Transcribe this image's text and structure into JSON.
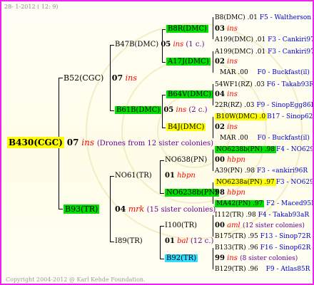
{
  "header": {
    "date_text": "28- 1-2012 ( 12: 9)"
  },
  "footer": {
    "copyright": "Copyright 2004-2012 @ Karl Kehde Foundation."
  },
  "root": {
    "label": "B430(CGC)",
    "year": "07",
    "breed": "ins",
    "note": "(Drones from 12 sister colonies)"
  },
  "father_side": {
    "label": "B52(CGC)",
    "year": "07",
    "breed": "ins",
    "gf": {
      "label": "B47B(DMC)",
      "year": "05",
      "breed": "ins",
      "note": "(1 c.)",
      "ggf": {
        "label": "B8R(DMC)",
        "year": "03",
        "breed": "ins",
        "l1": "B8(DMC) .01",
        "l1b": "F5 - Waltherson",
        "l2": "A199(DMC) .01",
        "l2b": "F3 - Cankiri97Q"
      },
      "ggm": {
        "label": "A17J(DMC)",
        "year": "02",
        "breed": "ins",
        "l1": "A199(DMC) .01",
        "l1b": "F3 - Cankiri97Q",
        "l2": "MAR .00",
        "l2b": "F0 - Buckfast(il)"
      }
    },
    "gm": {
      "label": "B61B(DMC)",
      "year": "05",
      "breed": "ins",
      "note": "(2 c.)",
      "ggf": {
        "label": "B64V(DMC)",
        "year": "04",
        "breed": "ins",
        "l1": "54WF1(RZ) .03",
        "l1b": "F6 - Takab93R",
        "l2": "22R(RZ) .03",
        "l2b": "F9 - SinopEgg86R"
      },
      "ggm": {
        "label": "B4J(DMC)",
        "year": "02",
        "breed": "ins",
        "l1": "B10W(DMC) .0",
        "l1b": "B17 - Sinop62R",
        "l2": "MAR .00",
        "l2b": "F0 - Buckfast(il)"
      }
    }
  },
  "mother_side": {
    "label": "B93(TR)",
    "year": "04",
    "breed": "mrk",
    "note": "(15 sister colonies)",
    "gf": {
      "label": "NO61(TR)",
      "year": "01",
      "breed": "hbpn",
      "ggf": {
        "label": "NO638(PN)",
        "year": "00",
        "breed": "hbpn",
        "l1": "NO6238b(PN) .98",
        "l1b": "F4 - NO6294R",
        "l2": "A39(PN) .98",
        "l2b": "F3 - «ankiri96R"
      },
      "ggm": {
        "label": "NO6238b(PN)",
        "year": "98",
        "breed": "hbpn",
        "l1": "NO6238a(PN) .97",
        "l1b": "F3 - NO6294R",
        "l2": "MA42(PN) .97",
        "l2b": "F2 - Maced95R"
      }
    },
    "gm": {
      "label": "I89(TR)",
      "year": "01",
      "breed": "bal",
      "note": "(12 c.)",
      "ggf": {
        "label": "I100(TR)",
        "year": "00",
        "breed": "aml",
        "note": "(12 sister colonies)",
        "l1": "I112(TR) .98",
        "l1b": "F4 - Takab93aR",
        "l2": "B175(TR) .95",
        "l2b": "F13 - Sinop72R"
      },
      "ggm": {
        "label": "B92(TR)",
        "year": "99",
        "breed": "ins",
        "note": "(8 sister colonies)",
        "l1": "B133(TR) .96",
        "l1b": "F16 - Sinop62R",
        "l2": "B129(TR) .96",
        "l2b": "F9 - Atlas85R"
      }
    }
  }
}
